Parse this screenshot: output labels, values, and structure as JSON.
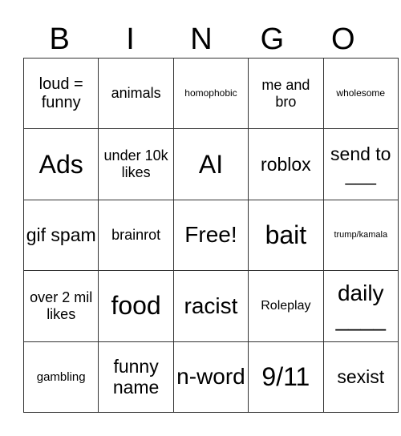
{
  "header": {
    "letters": [
      "B",
      "I",
      "N",
      "G",
      "O"
    ]
  },
  "board": {
    "rows": [
      [
        "loud = funny",
        "animals",
        "homophobic",
        "me and bro",
        "wholesome"
      ],
      [
        "Ads",
        "under 10k likes",
        "AI",
        "roblox",
        "send to ___"
      ],
      [
        "gif spam",
        "brainrot",
        "Free!",
        "bait",
        "trump/kamala"
      ],
      [
        "over 2 mil likes",
        "food",
        "racist",
        "Roleplay",
        "daily ____"
      ],
      [
        "gambling",
        "funny name",
        "n-word",
        "9/11",
        "sexist"
      ]
    ],
    "free_space": "Free!"
  }
}
